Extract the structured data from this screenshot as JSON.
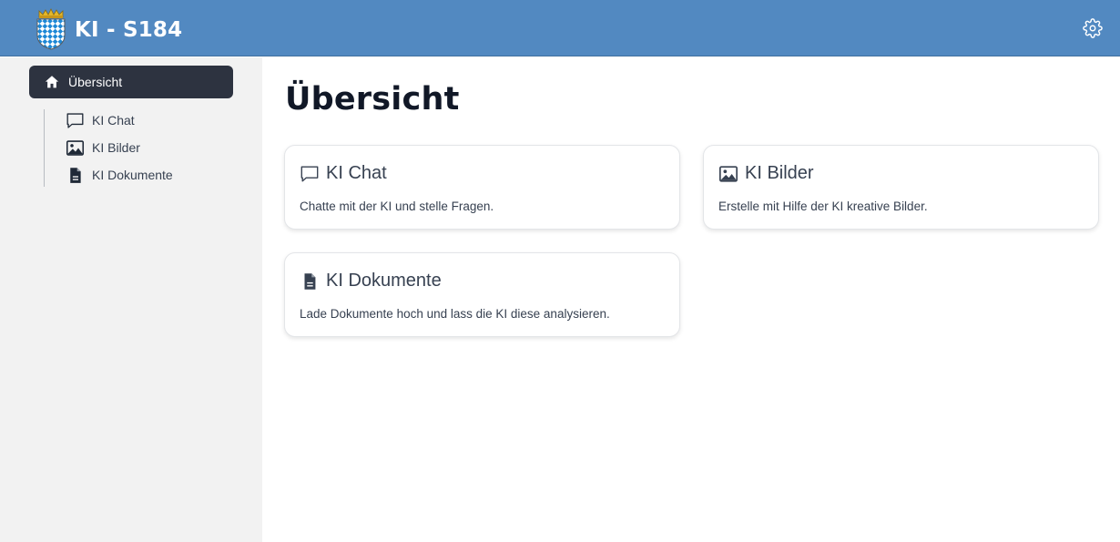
{
  "header": {
    "title": "KI - S184",
    "background_color": "#5289c1",
    "logo_icon": "bavarian-crest-icon",
    "settings_icon": "gear-icon"
  },
  "sidebar": {
    "items": [
      {
        "label": "Übersicht",
        "icon": "home-icon",
        "active": true
      },
      {
        "label": "KI Chat",
        "icon": "chat-bubble-icon",
        "active": false
      },
      {
        "label": "KI Bilder",
        "icon": "image-icon",
        "active": false
      },
      {
        "label": "KI Dokumente",
        "icon": "document-icon",
        "active": false
      }
    ],
    "active_color": "#2d3340"
  },
  "main": {
    "title": "Übersicht",
    "cards": [
      {
        "title": "KI Chat",
        "description": "Chatte mit der KI und stelle Fragen.",
        "icon": "chat-bubble-icon"
      },
      {
        "title": "KI Bilder",
        "description": "Erstelle mit Hilfe der KI kreative Bilder.",
        "icon": "image-icon"
      },
      {
        "title": "KI Dokumente",
        "description": "Lade Dokumente hoch und lass die KI diese analysieren.",
        "icon": "document-icon"
      }
    ]
  }
}
